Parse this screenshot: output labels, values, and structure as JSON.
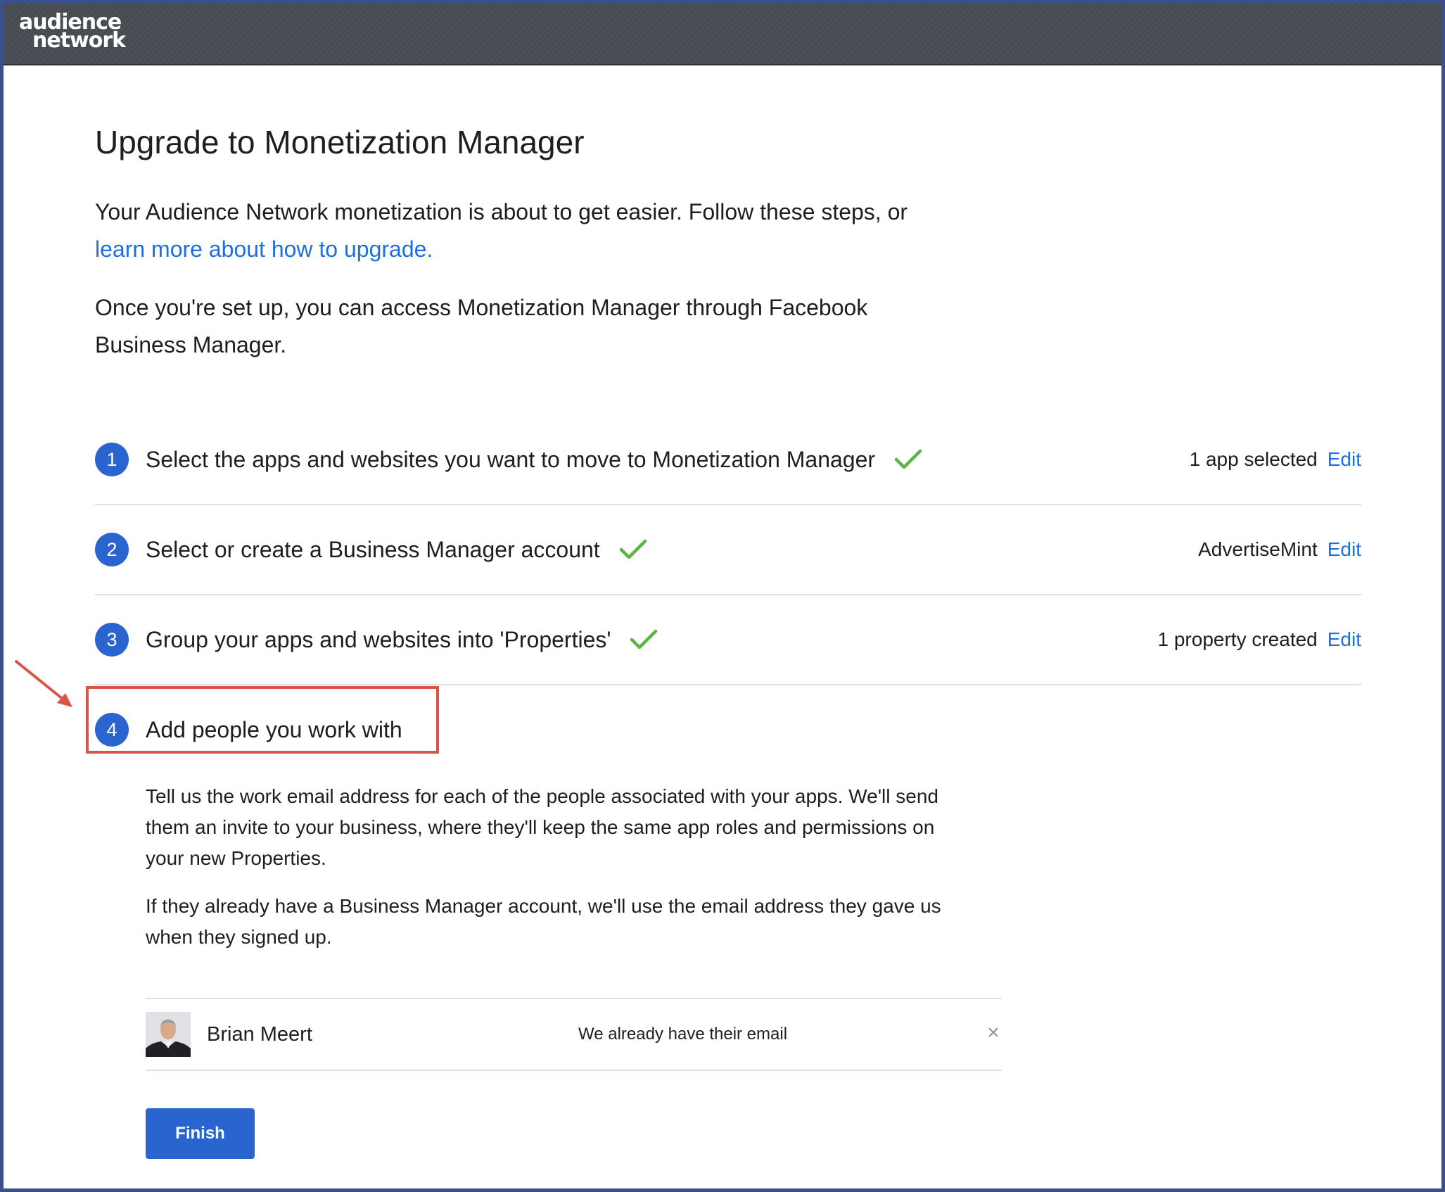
{
  "brand": {
    "line1": "audience",
    "line2": "network"
  },
  "page": {
    "title": "Upgrade to Monetization Manager",
    "intro1_text": "Your Audience Network monetization is about to get easier. Follow these steps, or ",
    "intro1_link": "learn more about how to upgrade.",
    "intro2": "Once you're set up, you can access Monetization Manager through Facebook Business Manager."
  },
  "steps": [
    {
      "number": "1",
      "title": "Select the apps and websites you want to move to Monetization Manager",
      "status": "1 app selected",
      "action": "Edit",
      "completed": true
    },
    {
      "number": "2",
      "title": "Select or create a Business Manager account",
      "status": "AdvertiseMint",
      "action": "Edit",
      "completed": true
    },
    {
      "number": "3",
      "title": "Group your apps and websites into 'Properties'",
      "status": "1 property created",
      "action": "Edit",
      "completed": true
    },
    {
      "number": "4",
      "title": "Add people you work with"
    }
  ],
  "step4": {
    "desc1": "Tell us the work email address for each of the people associated with your apps. We'll send them an invite to your business, where they'll keep the same app roles and permissions on your new Properties.",
    "desc2": "If they already have a Business Manager account, we'll use the email address they gave us when they signed up.",
    "people": [
      {
        "name": "Brian Meert",
        "status": "We already have their email",
        "remove": "×"
      }
    ],
    "finish_label": "Finish"
  },
  "colors": {
    "accent": "#2a64cf",
    "link": "#1d6ee0",
    "check": "#5bb543",
    "highlight": "#d9554a",
    "topbar": "#4b4f56"
  }
}
